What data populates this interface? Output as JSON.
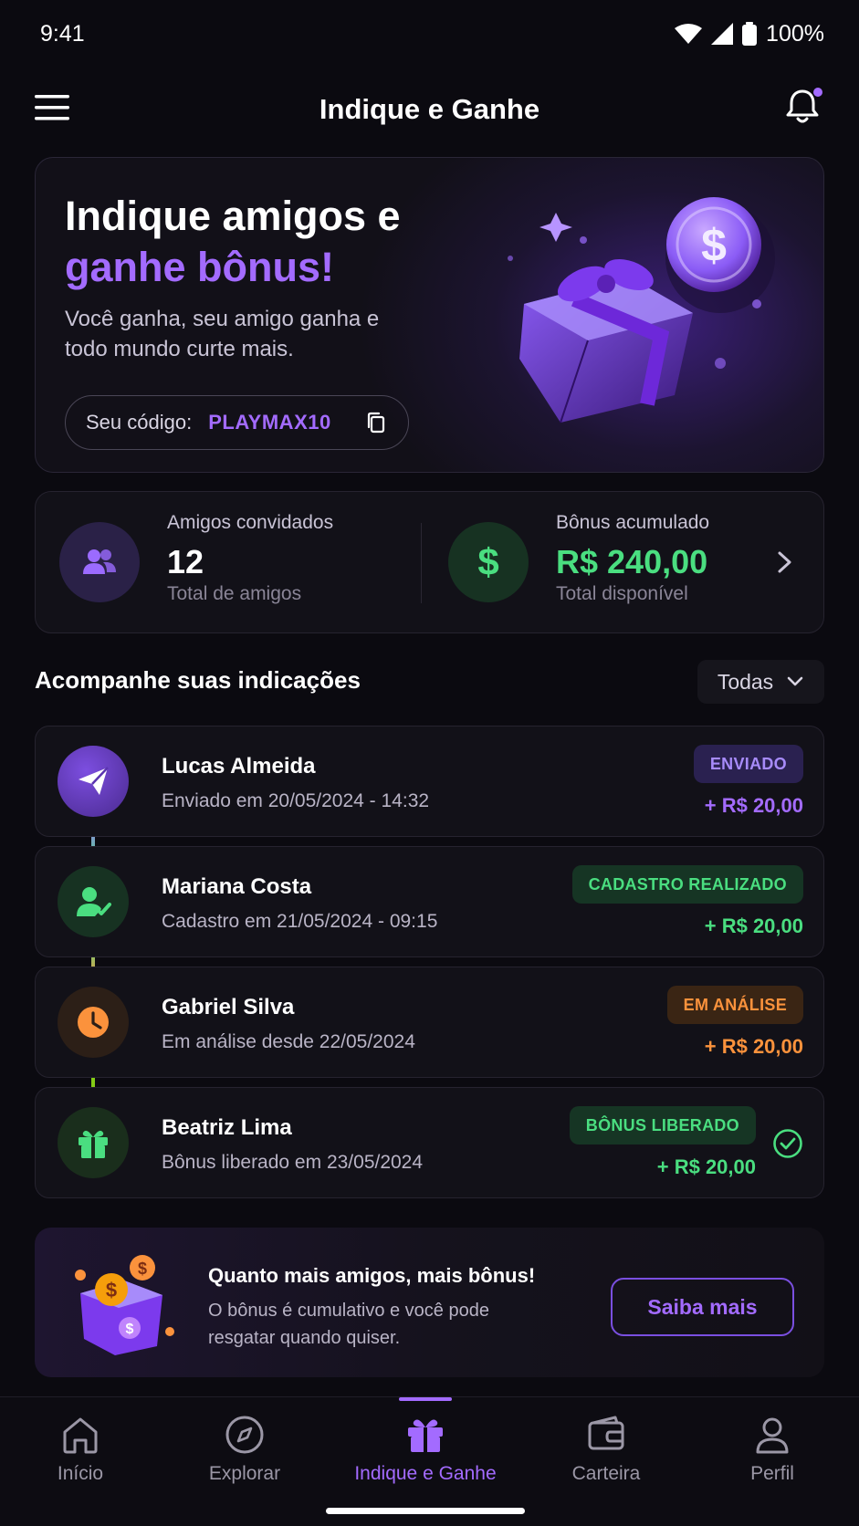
{
  "status_bar": {
    "time": "9:41",
    "battery": "100%"
  },
  "app_bar": {
    "title": "Indique e Ganhe"
  },
  "hero": {
    "title_line1": "Indique amigos e",
    "title_line2": "ganhe bônus!",
    "subtitle": "Você ganha, seu amigo ganha e todo mundo curte mais.",
    "code_label": "Seu código:",
    "code_value": "PLAYMAX10"
  },
  "stats": {
    "friends": {
      "label": "Amigos convidados",
      "value": "12",
      "sub": "Total de amigos"
    },
    "bonus": {
      "label": "Bônus acumulado",
      "value": "R$ 240,00",
      "sub": "Total disponível"
    }
  },
  "section": {
    "title": "Acompanhe suas indicações",
    "filter": "Todas"
  },
  "referrals": [
    {
      "name": "Lucas Almeida",
      "date": "Enviado em 20/05/2024 - 14:32",
      "status": "ENVIADO",
      "amount": "+ R$ 20,00",
      "icon": "send-icon",
      "color": "#a36bff"
    },
    {
      "name": "Mariana Costa",
      "date": "Cadastro em 21/05/2024 - 09:15",
      "status": "CADASTRO REALIZADO",
      "amount": "+ R$ 20,00",
      "icon": "user-check-icon",
      "color": "#4ade80"
    },
    {
      "name": "Gabriel Silva",
      "date": "Em análise desde 22/05/2024",
      "status": "EM ANÁLISE",
      "amount": "+ R$ 20,00",
      "icon": "clock-icon",
      "color": "#fb923c"
    },
    {
      "name": "Beatriz Lima",
      "date": "Bônus liberado em 23/05/2024",
      "status": "BÔNUS LIBERADO",
      "amount": "+ R$ 20,00",
      "icon": "gift-icon",
      "color": "#4ade80"
    }
  ],
  "promo": {
    "title": "Quanto mais amigos, mais bônus!",
    "text": "O bônus é cumulativo e você pode resgatar quando quiser.",
    "button": "Saiba mais"
  },
  "nav": [
    {
      "label": "Início",
      "icon": "home-icon",
      "active": false
    },
    {
      "label": "Explorar",
      "icon": "compass-icon",
      "active": false
    },
    {
      "label": "Indique e Ganhe",
      "icon": "gift-icon",
      "active": true
    },
    {
      "label": "Carteira",
      "icon": "wallet-icon",
      "active": false
    },
    {
      "label": "Perfil",
      "icon": "profile-icon",
      "active": false
    }
  ],
  "colors": {
    "accent": "#a36bff",
    "success": "#4ade80",
    "warning": "#fb923c",
    "background": "#0b0a10"
  }
}
